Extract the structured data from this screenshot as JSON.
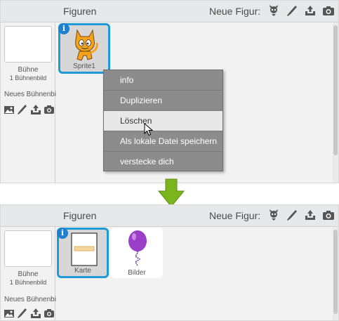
{
  "top": {
    "header": {
      "title": "Figuren",
      "new_sprite_label": "Neue Figur:"
    },
    "stage": {
      "name": "Bühne",
      "sub": "1 Bühnenbild",
      "new_backdrop_label": "Neues Bühnenbild"
    },
    "sprites": [
      {
        "label": "Sprite1",
        "info": "i"
      }
    ],
    "context_menu": {
      "items": [
        {
          "label": "info"
        },
        {
          "label": "Duplizieren"
        },
        {
          "label": "Löschen"
        },
        {
          "label": "Als lokale Datei speichern"
        },
        {
          "label": "verstecke dich"
        }
      ]
    }
  },
  "bottom": {
    "header": {
      "title": "Figuren",
      "new_sprite_label": "Neue Figur:"
    },
    "stage": {
      "name": "Bühne",
      "sub": "1 Bühnenbild",
      "new_backdrop_label": "Neues Bühnenbild"
    },
    "sprites": [
      {
        "label": "Karte",
        "info": "i"
      },
      {
        "label": "Bilder"
      }
    ]
  },
  "colors": {
    "accent": "#1f9ad6",
    "info": "#1f7fd0",
    "menu_bg": "#8c8c8c",
    "arrow": "#7ab51d",
    "balloon": "#9b3fc8"
  },
  "icons": [
    "choose-sprite-icon",
    "paint-brush-icon",
    "upload-icon",
    "camera-icon",
    "paint-landscape-icon"
  ]
}
